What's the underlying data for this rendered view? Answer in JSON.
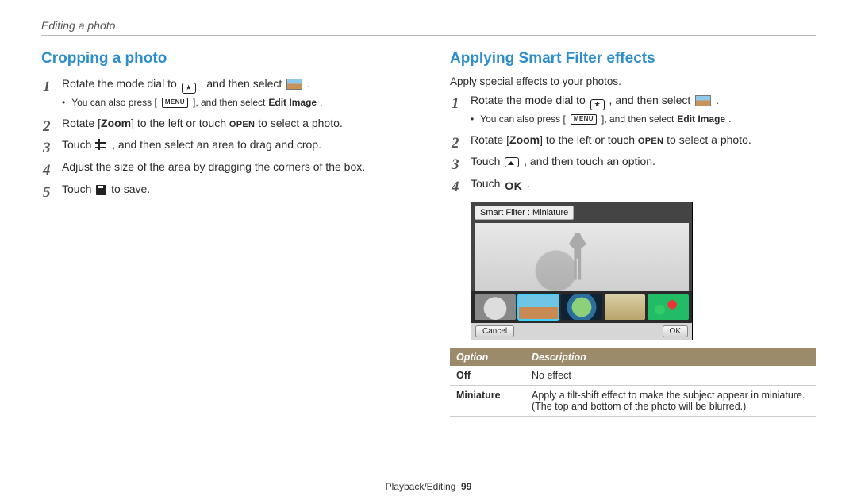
{
  "page_header": "Editing a photo",
  "footer_section": "Playback/Editing",
  "footer_page": "99",
  "left": {
    "heading": "Cropping a photo",
    "steps": {
      "s1a": "Rotate the mode dial to ",
      "s1b": ", and then select ",
      "s1c": ".",
      "s1_sub_a": "You can also press [",
      "s1_sub_menu": "MENU",
      "s1_sub_b": "], and then select ",
      "s1_sub_bold": "Edit Image",
      "s1_sub_c": ".",
      "s2a": "Rotate [",
      "s2_zoom": "Zoom",
      "s2b": "] to the left or touch ",
      "s2_open": "OPEN",
      "s2c": " to select a photo.",
      "s3a": "Touch ",
      "s3b": ", and then select an area to drag and crop.",
      "s4": "Adjust the size of the area by dragging the corners of the box.",
      "s5a": "Touch ",
      "s5b": " to save."
    }
  },
  "right": {
    "heading": "Applying Smart Filter effects",
    "intro": "Apply special effects to your photos.",
    "steps": {
      "s1a": "Rotate the mode dial to ",
      "s1b": ", and then select ",
      "s1c": ".",
      "s1_sub_a": "You can also press [",
      "s1_sub_menu": "MENU",
      "s1_sub_b": "], and then select ",
      "s1_sub_bold": "Edit Image",
      "s1_sub_c": ".",
      "s2a": "Rotate [",
      "s2_zoom": "Zoom",
      "s2b": "] to the left or touch ",
      "s2_open": "OPEN",
      "s2c": " to select a photo.",
      "s3a": "Touch ",
      "s3b": ", and then touch an option.",
      "s4a": "Touch ",
      "s4_ok": "OK",
      "s4b": "."
    },
    "screenshot": {
      "label": "Smart Filter : Miniature",
      "cancel": "Cancel",
      "ok": "OK"
    },
    "table": {
      "col_option": "Option",
      "col_desc": "Description",
      "rows": [
        {
          "k": "Off",
          "v": "No effect"
        },
        {
          "k": "Miniature",
          "v": "Apply a tilt-shift effect to make the subject appear in miniature. (The top and bottom of the photo will be blurred.)"
        }
      ]
    }
  }
}
